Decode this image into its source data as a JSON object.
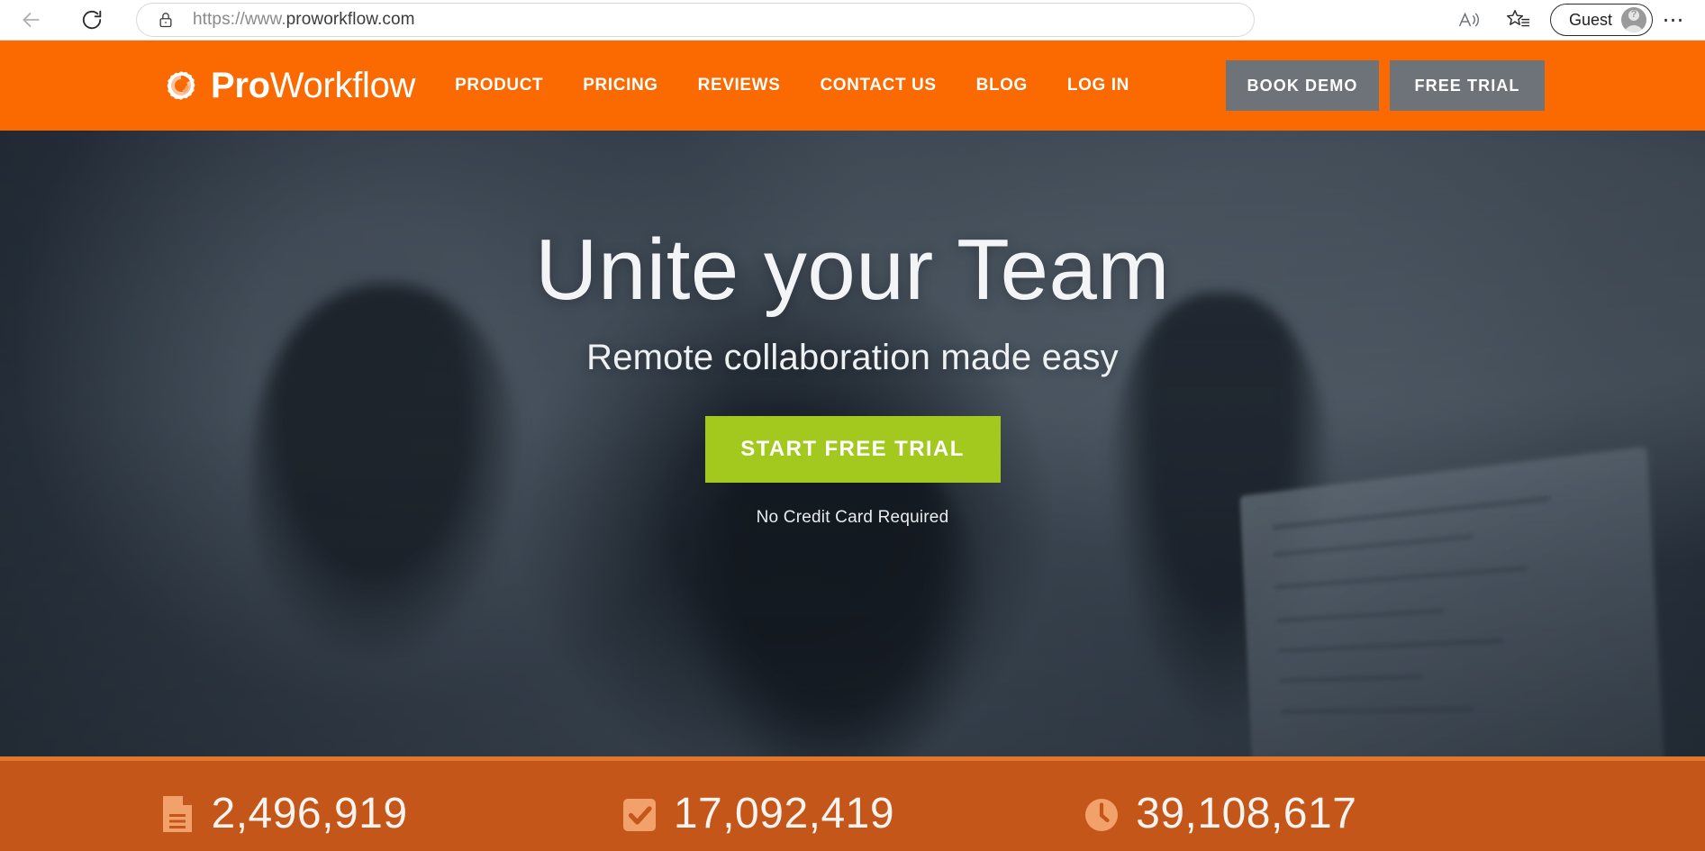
{
  "browser": {
    "back_icon": "back-arrow-icon",
    "reload_icon": "reload-icon",
    "lock_icon": "lock-icon",
    "url_scheme": "https://www.",
    "url_domain": "proworkflow.com",
    "url_full": "https://www.proworkflow.com",
    "read_aloud_icon": "read-aloud-icon",
    "favorites_icon": "favorites-star-icon",
    "profile_label": "Guest",
    "profile_avatar_icon": "guest-avatar-icon",
    "settings_icon": "ellipsis-icon",
    "settings_glyph": "⋯"
  },
  "site_header": {
    "logo_icon": "proworkflow-gear-logo-icon",
    "logo_text_bold": "Pro",
    "logo_text_light": "Workflow",
    "nav_items": [
      {
        "label": "PRODUCT",
        "name": "nav-link-product"
      },
      {
        "label": "PRICING",
        "name": "nav-link-pricing"
      },
      {
        "label": "REVIEWS",
        "name": "nav-link-reviews"
      },
      {
        "label": "CONTACT US",
        "name": "nav-link-contact-us"
      },
      {
        "label": "BLOG",
        "name": "nav-link-blog"
      },
      {
        "label": "LOG IN",
        "name": "nav-link-log-in"
      }
    ],
    "book_demo_label": "BOOK DEMO",
    "free_trial_label": "FREE TRIAL",
    "background_color": "#fa6a00",
    "button_color": "#6e7379"
  },
  "hero": {
    "title": "Unite your Team",
    "subtitle": "Remote collaboration made easy",
    "cta_label": "START FREE TRIAL",
    "cta_color": "#a3c81e",
    "note": "No Credit Card Required",
    "background_color": "#2d3742"
  },
  "stats_bar": {
    "background_color": "#c4561a",
    "icon_color": "#f2a16a",
    "items": [
      {
        "icon": "document-icon",
        "value": "2,496,919",
        "name": "stat-projects"
      },
      {
        "icon": "check-square-icon",
        "value": "17,092,419",
        "name": "stat-tasks"
      },
      {
        "icon": "clock-icon",
        "value": "39,108,617",
        "name": "stat-hours"
      }
    ]
  }
}
